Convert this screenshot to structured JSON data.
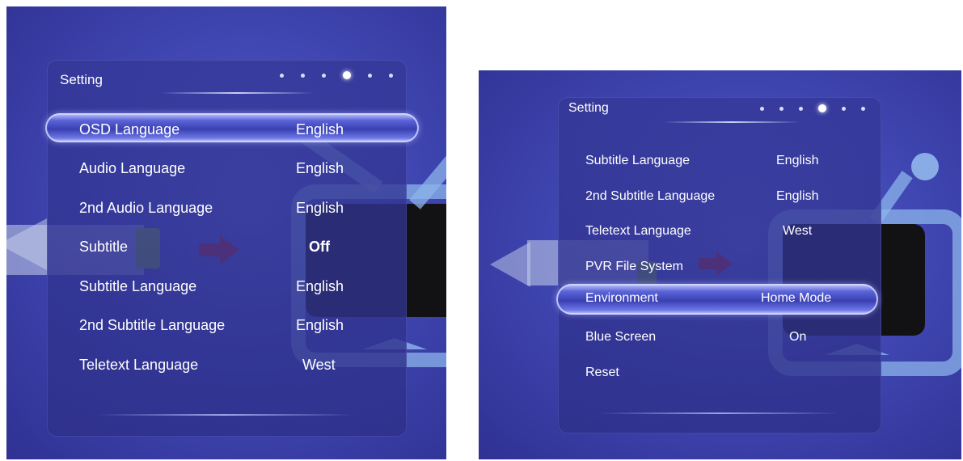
{
  "colors": {
    "background_top": "#5a62cf",
    "background_bottom": "#2f3192",
    "text": "#ffffff",
    "highlight": "#6d76e6",
    "tv_frame": "#8cb4eb",
    "tv_screen": "#121214",
    "plug_green": "#7aa93a",
    "arrow_red": "#b3262a"
  },
  "left_panel": {
    "title": "Setting",
    "page_indicator": {
      "total": 6,
      "active_index": 3
    },
    "items": [
      {
        "label": "OSD Language",
        "value": "English",
        "selected": true
      },
      {
        "label": "Audio Language",
        "value": "English",
        "selected": false
      },
      {
        "label": "2nd Audio Language",
        "value": "English",
        "selected": false
      },
      {
        "label": "Subtitle",
        "value": "Off",
        "selected": false
      },
      {
        "label": "Subtitle Language",
        "value": "English",
        "selected": false
      },
      {
        "label": "2nd Subtitle Language",
        "value": "English",
        "selected": false
      },
      {
        "label": "Teletext Language",
        "value": "West",
        "selected": false
      }
    ]
  },
  "right_panel": {
    "title": "Setting",
    "page_indicator": {
      "total": 6,
      "active_index": 3
    },
    "items": [
      {
        "label": "Subtitle Language",
        "value": "English",
        "selected": false
      },
      {
        "label": "2nd Subtitle Language",
        "value": "English",
        "selected": false
      },
      {
        "label": "Teletext Language",
        "value": "West",
        "selected": false
      },
      {
        "label": "PVR File System",
        "value": "",
        "selected": false
      },
      {
        "label": "Environment",
        "value": "Home Mode",
        "selected": true
      },
      {
        "label": "Blue Screen",
        "value": "On",
        "selected": false
      },
      {
        "label": "Reset",
        "value": "",
        "selected": false
      }
    ]
  },
  "icons": {
    "tv_illustration": "tv-icon",
    "plug_illustration": "plug-icon",
    "arrow": "right-arrow-icon"
  }
}
